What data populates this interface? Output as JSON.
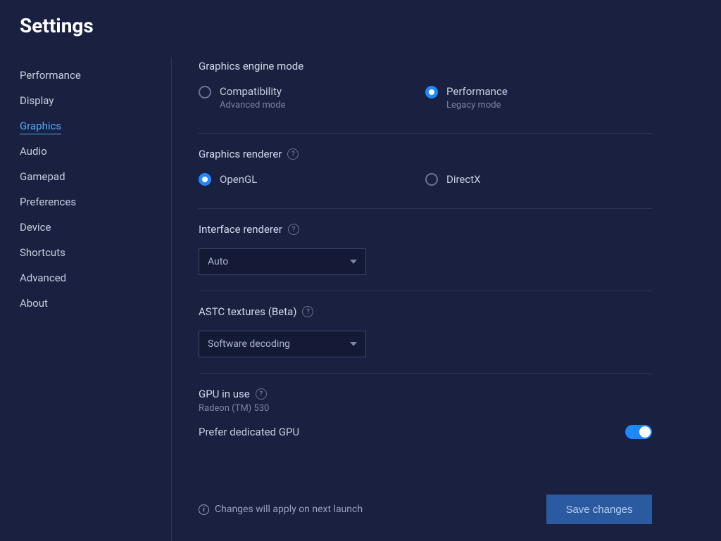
{
  "title": "Settings",
  "sidebar": {
    "items": [
      {
        "label": "Performance"
      },
      {
        "label": "Display"
      },
      {
        "label": "Graphics"
      },
      {
        "label": "Audio"
      },
      {
        "label": "Gamepad"
      },
      {
        "label": "Preferences"
      },
      {
        "label": "Device"
      },
      {
        "label": "Shortcuts"
      },
      {
        "label": "Advanced"
      },
      {
        "label": "About"
      }
    ],
    "activeIndex": 2
  },
  "graphics": {
    "engineMode": {
      "title": "Graphics engine mode",
      "options": [
        {
          "label": "Compatibility",
          "sub": "Advanced mode",
          "selected": false
        },
        {
          "label": "Performance",
          "sub": "Legacy mode",
          "selected": true
        }
      ]
    },
    "renderer": {
      "title": "Graphics renderer",
      "options": [
        {
          "label": "OpenGL",
          "selected": true
        },
        {
          "label": "DirectX",
          "selected": false
        }
      ]
    },
    "interfaceRenderer": {
      "title": "Interface renderer",
      "value": "Auto"
    },
    "astc": {
      "title": "ASTC textures (Beta)",
      "value": "Software decoding"
    },
    "gpu": {
      "title": "GPU in use",
      "name": "Radeon (TM) 530",
      "preferLabel": "Prefer dedicated GPU",
      "preferOn": true
    }
  },
  "footer": {
    "note": "Changes will apply on next launch",
    "saveLabel": "Save changes"
  },
  "colors": {
    "accent": "#1e88ff",
    "background": "#1a2040"
  }
}
